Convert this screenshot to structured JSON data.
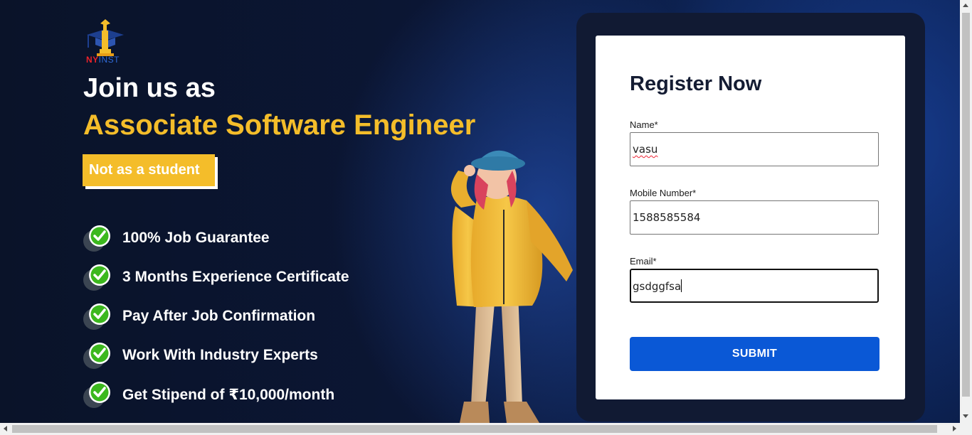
{
  "logo": {
    "text_ny": "NY",
    "text_inst": "INST"
  },
  "hero": {
    "headline": "Join us as",
    "role": "Associate Software Engineer",
    "tag": "Not as a student"
  },
  "features": [
    {
      "text": "100% Job Guarantee"
    },
    {
      "text": "3 Months Experience Certificate"
    },
    {
      "text": "Pay After Job Confirmation"
    },
    {
      "text": "Work With Industry Experts"
    },
    {
      "text": "Get Stipend of ₹10,000/month"
    }
  ],
  "form": {
    "title": "Register Now",
    "name_label": "Name*",
    "name_value": "vasu",
    "mobile_label": "Mobile Number*",
    "mobile_value": "1588585584",
    "email_label": "Email*",
    "email_value": "gsdggfsa",
    "submit_label": "SUBMIT"
  },
  "colors": {
    "accent_yellow": "#f4bd2a",
    "submit_blue": "#0a58d6",
    "check_green": "#3cb81e",
    "background": "#0b1634"
  },
  "icons": [
    "logo-icon",
    "check-icon",
    "scroll-up-arrow-icon",
    "scroll-down-arrow-icon",
    "scroll-left-arrow-icon",
    "scroll-right-arrow-icon"
  ]
}
